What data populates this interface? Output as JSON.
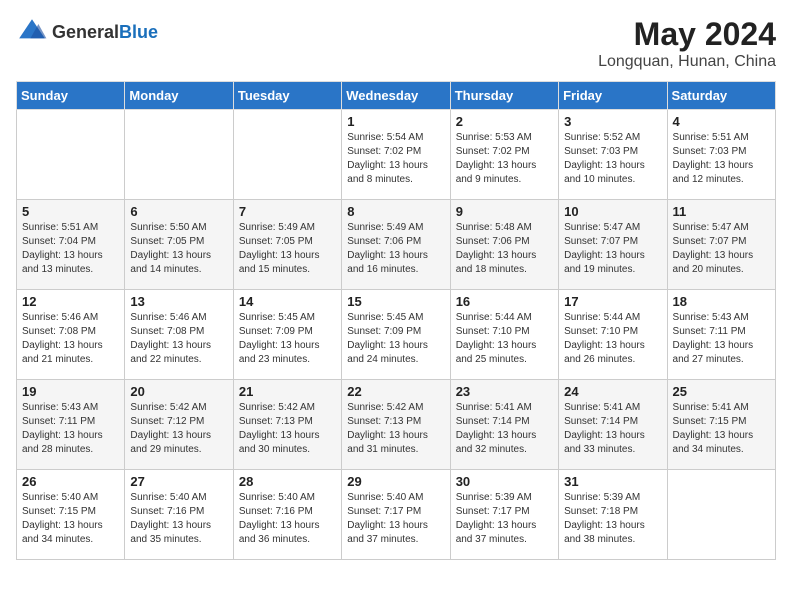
{
  "header": {
    "logo_general": "General",
    "logo_blue": "Blue",
    "month_year": "May 2024",
    "location": "Longquan, Hunan, China"
  },
  "days_of_week": [
    "Sunday",
    "Monday",
    "Tuesday",
    "Wednesday",
    "Thursday",
    "Friday",
    "Saturday"
  ],
  "weeks": [
    [
      {
        "day": "",
        "info": ""
      },
      {
        "day": "",
        "info": ""
      },
      {
        "day": "",
        "info": ""
      },
      {
        "day": "1",
        "info": "Sunrise: 5:54 AM\nSunset: 7:02 PM\nDaylight: 13 hours and 8 minutes."
      },
      {
        "day": "2",
        "info": "Sunrise: 5:53 AM\nSunset: 7:02 PM\nDaylight: 13 hours and 9 minutes."
      },
      {
        "day": "3",
        "info": "Sunrise: 5:52 AM\nSunset: 7:03 PM\nDaylight: 13 hours and 10 minutes."
      },
      {
        "day": "4",
        "info": "Sunrise: 5:51 AM\nSunset: 7:03 PM\nDaylight: 13 hours and 12 minutes."
      }
    ],
    [
      {
        "day": "5",
        "info": "Sunrise: 5:51 AM\nSunset: 7:04 PM\nDaylight: 13 hours and 13 minutes."
      },
      {
        "day": "6",
        "info": "Sunrise: 5:50 AM\nSunset: 7:05 PM\nDaylight: 13 hours and 14 minutes."
      },
      {
        "day": "7",
        "info": "Sunrise: 5:49 AM\nSunset: 7:05 PM\nDaylight: 13 hours and 15 minutes."
      },
      {
        "day": "8",
        "info": "Sunrise: 5:49 AM\nSunset: 7:06 PM\nDaylight: 13 hours and 16 minutes."
      },
      {
        "day": "9",
        "info": "Sunrise: 5:48 AM\nSunset: 7:06 PM\nDaylight: 13 hours and 18 minutes."
      },
      {
        "day": "10",
        "info": "Sunrise: 5:47 AM\nSunset: 7:07 PM\nDaylight: 13 hours and 19 minutes."
      },
      {
        "day": "11",
        "info": "Sunrise: 5:47 AM\nSunset: 7:07 PM\nDaylight: 13 hours and 20 minutes."
      }
    ],
    [
      {
        "day": "12",
        "info": "Sunrise: 5:46 AM\nSunset: 7:08 PM\nDaylight: 13 hours and 21 minutes."
      },
      {
        "day": "13",
        "info": "Sunrise: 5:46 AM\nSunset: 7:08 PM\nDaylight: 13 hours and 22 minutes."
      },
      {
        "day": "14",
        "info": "Sunrise: 5:45 AM\nSunset: 7:09 PM\nDaylight: 13 hours and 23 minutes."
      },
      {
        "day": "15",
        "info": "Sunrise: 5:45 AM\nSunset: 7:09 PM\nDaylight: 13 hours and 24 minutes."
      },
      {
        "day": "16",
        "info": "Sunrise: 5:44 AM\nSunset: 7:10 PM\nDaylight: 13 hours and 25 minutes."
      },
      {
        "day": "17",
        "info": "Sunrise: 5:44 AM\nSunset: 7:10 PM\nDaylight: 13 hours and 26 minutes."
      },
      {
        "day": "18",
        "info": "Sunrise: 5:43 AM\nSunset: 7:11 PM\nDaylight: 13 hours and 27 minutes."
      }
    ],
    [
      {
        "day": "19",
        "info": "Sunrise: 5:43 AM\nSunset: 7:11 PM\nDaylight: 13 hours and 28 minutes."
      },
      {
        "day": "20",
        "info": "Sunrise: 5:42 AM\nSunset: 7:12 PM\nDaylight: 13 hours and 29 minutes."
      },
      {
        "day": "21",
        "info": "Sunrise: 5:42 AM\nSunset: 7:13 PM\nDaylight: 13 hours and 30 minutes."
      },
      {
        "day": "22",
        "info": "Sunrise: 5:42 AM\nSunset: 7:13 PM\nDaylight: 13 hours and 31 minutes."
      },
      {
        "day": "23",
        "info": "Sunrise: 5:41 AM\nSunset: 7:14 PM\nDaylight: 13 hours and 32 minutes."
      },
      {
        "day": "24",
        "info": "Sunrise: 5:41 AM\nSunset: 7:14 PM\nDaylight: 13 hours and 33 minutes."
      },
      {
        "day": "25",
        "info": "Sunrise: 5:41 AM\nSunset: 7:15 PM\nDaylight: 13 hours and 34 minutes."
      }
    ],
    [
      {
        "day": "26",
        "info": "Sunrise: 5:40 AM\nSunset: 7:15 PM\nDaylight: 13 hours and 34 minutes."
      },
      {
        "day": "27",
        "info": "Sunrise: 5:40 AM\nSunset: 7:16 PM\nDaylight: 13 hours and 35 minutes."
      },
      {
        "day": "28",
        "info": "Sunrise: 5:40 AM\nSunset: 7:16 PM\nDaylight: 13 hours and 36 minutes."
      },
      {
        "day": "29",
        "info": "Sunrise: 5:40 AM\nSunset: 7:17 PM\nDaylight: 13 hours and 37 minutes."
      },
      {
        "day": "30",
        "info": "Sunrise: 5:39 AM\nSunset: 7:17 PM\nDaylight: 13 hours and 37 minutes."
      },
      {
        "day": "31",
        "info": "Sunrise: 5:39 AM\nSunset: 7:18 PM\nDaylight: 13 hours and 38 minutes."
      },
      {
        "day": "",
        "info": ""
      }
    ]
  ]
}
